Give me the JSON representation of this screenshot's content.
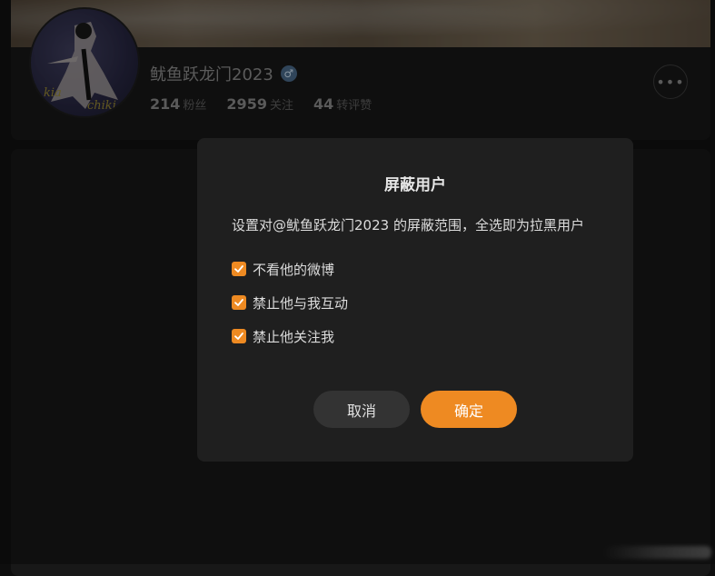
{
  "profile": {
    "username": "鱿鱼跃龙门2023",
    "gender_icon": "male-icon",
    "gender_symbol": "♂",
    "avatar_text": "kia\nchiki",
    "stats": [
      {
        "value": "214",
        "label": "粉丝"
      },
      {
        "value": "2959",
        "label": "关注"
      },
      {
        "value": "44",
        "label": "转评赞"
      }
    ],
    "more_symbol": "•••"
  },
  "dialog": {
    "title": "屏蔽用户",
    "description": "设置对@鱿鱼跃龙门2023 的屏蔽范围，全选即为拉黑用户",
    "options": [
      {
        "label": "不看他的微博",
        "checked": true
      },
      {
        "label": "禁止他与我互动",
        "checked": true
      },
      {
        "label": "禁止他关注我",
        "checked": true
      }
    ],
    "cancel_label": "取消",
    "confirm_label": "确定"
  },
  "colors": {
    "accent": "#ee8a22",
    "dialog_bg": "#1f1f1f",
    "page_bg": "#121212"
  }
}
